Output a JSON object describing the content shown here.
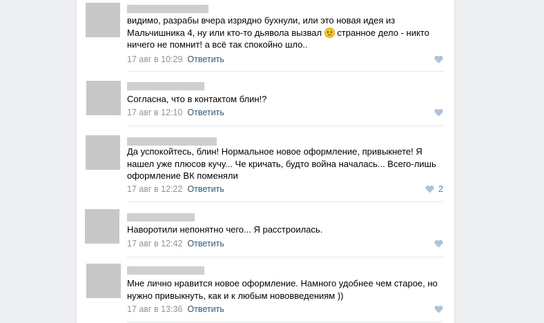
{
  "comments": [
    {
      "text_before_emoji": "видимо, разрабы вчера изрядно бухнули, или это новая идея из\nМальчишника 4, ну или кто-то дьявола вызвал ",
      "emoji": "neutral-face-emoji",
      "text_after_emoji": " странное дело - никто\nничего не помнит! а всё так спокойно шло..",
      "date": "17 авг в 10:29",
      "reply_label": "Ответить",
      "like_count": ""
    },
    {
      "text": "Согласна, что в контактом блин!?",
      "date": "17 авг в 12:10",
      "reply_label": "Ответить",
      "like_count": ""
    },
    {
      "text": "Да успокойтесь, блин! Нормальное новое оформление, привыкнете! Я\nнашел уже плюсов кучу... Че кричать, будто война началась... Всего-лишь\nоформление ВК поменяли",
      "date": "17 авг в 12:22",
      "reply_label": "Ответить",
      "like_count": "2"
    },
    {
      "text": "Наворотили непонятно чего... Я расстроилась.",
      "date": "17 авг в 12:42",
      "reply_label": "Ответить",
      "like_count": ""
    },
    {
      "text": "Мне лично нравится новое оформление. Намного удобнее чем старое, но\nнужно привыкнуть, как и к любым нововведениям ))",
      "date": "17 авг в 13:36",
      "reply_label": "Ответить",
      "like_count": ""
    }
  ],
  "colors": {
    "link": "#2a5885",
    "date": "#939393",
    "like": "#5181b8"
  }
}
